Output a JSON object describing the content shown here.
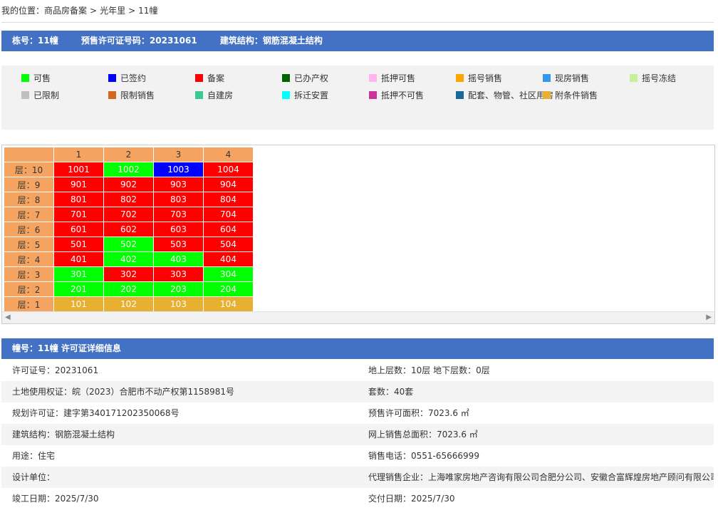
{
  "breadcrumb": {
    "prefix": "我的位置：",
    "items": [
      "商品房备案",
      "光年里",
      "11幢"
    ],
    "sep": ">"
  },
  "header": {
    "building": "栋号：11幢",
    "permit": "预售许可证号码：20231061",
    "structure": "建筑结构：钢筋混凝土结构"
  },
  "legend": [
    {
      "label": "可售",
      "color": "#00ff00"
    },
    {
      "label": "已签约",
      "color": "#0000ff"
    },
    {
      "label": "备案",
      "color": "#ff0000"
    },
    {
      "label": "已办产权",
      "color": "#006400"
    },
    {
      "label": "抵押可售",
      "color": "#ffb6f0"
    },
    {
      "label": "摇号销售",
      "color": "#ffa500"
    },
    {
      "label": "现房销售",
      "color": "#3399ee"
    },
    {
      "label": "摇号冻结",
      "color": "#c8f09a"
    },
    {
      "label": "已限制",
      "color": "#c0c0c0"
    },
    {
      "label": "限制销售",
      "color": "#d2691e"
    },
    {
      "label": "自建房",
      "color": "#3cc890"
    },
    {
      "label": "拆迁安置",
      "color": "#00ffff"
    },
    {
      "label": "抵押不可售",
      "color": "#cc3399"
    },
    {
      "label": "配套、物管、社区用房",
      "color": "#1a6a99"
    },
    {
      "label": "附条件销售",
      "color": "#e8b030"
    }
  ],
  "grid": {
    "columns": [
      "1",
      "2",
      "3",
      "4"
    ],
    "floor_prefix": "层：",
    "status_colors": {
      "available": "#00ff00",
      "signed": "#0000ff",
      "filed": "#ff0000",
      "conditional": "#e8b030"
    },
    "rows": [
      {
        "floor": "10",
        "units": [
          [
            "1001",
            "filed"
          ],
          [
            "1002",
            "available"
          ],
          [
            "1003",
            "signed"
          ],
          [
            "1004",
            "filed"
          ]
        ]
      },
      {
        "floor": "9",
        "units": [
          [
            "901",
            "filed"
          ],
          [
            "902",
            "filed"
          ],
          [
            "903",
            "filed"
          ],
          [
            "904",
            "filed"
          ]
        ]
      },
      {
        "floor": "8",
        "units": [
          [
            "801",
            "filed"
          ],
          [
            "802",
            "filed"
          ],
          [
            "803",
            "filed"
          ],
          [
            "804",
            "filed"
          ]
        ]
      },
      {
        "floor": "7",
        "units": [
          [
            "701",
            "filed"
          ],
          [
            "702",
            "filed"
          ],
          [
            "703",
            "filed"
          ],
          [
            "704",
            "filed"
          ]
        ]
      },
      {
        "floor": "6",
        "units": [
          [
            "601",
            "filed"
          ],
          [
            "602",
            "filed"
          ],
          [
            "603",
            "filed"
          ],
          [
            "604",
            "filed"
          ]
        ]
      },
      {
        "floor": "5",
        "units": [
          [
            "501",
            "filed"
          ],
          [
            "502",
            "available"
          ],
          [
            "503",
            "filed"
          ],
          [
            "504",
            "filed"
          ]
        ]
      },
      {
        "floor": "4",
        "units": [
          [
            "401",
            "filed"
          ],
          [
            "402",
            "available"
          ],
          [
            "403",
            "available"
          ],
          [
            "404",
            "filed"
          ]
        ]
      },
      {
        "floor": "3",
        "units": [
          [
            "301",
            "available"
          ],
          [
            "302",
            "filed"
          ],
          [
            "303",
            "filed"
          ],
          [
            "304",
            "available"
          ]
        ]
      },
      {
        "floor": "2",
        "units": [
          [
            "201",
            "available"
          ],
          [
            "202",
            "available"
          ],
          [
            "203",
            "available"
          ],
          [
            "204",
            "available"
          ]
        ]
      },
      {
        "floor": "1",
        "units": [
          [
            "101",
            "conditional"
          ],
          [
            "102",
            "conditional"
          ],
          [
            "103",
            "conditional"
          ],
          [
            "104",
            "conditional"
          ]
        ]
      }
    ]
  },
  "details_header": "幢号：11幢 许可证详细信息",
  "details": [
    {
      "left": "许可证号：20231061",
      "right": "地上层数：10层  地下层数：0层"
    },
    {
      "left": "土地使用权证：皖（2023）合肥市不动产权第1158981号",
      "right": "套数：40套"
    },
    {
      "left": "规划许可证：建字第340171202350068号",
      "right": "预售许可面积：7023.6 ㎡"
    },
    {
      "left": "建筑结构：钢筋混凝土结构",
      "right": "网上销售总面积：7023.6 ㎡"
    },
    {
      "left": "用途：住宅",
      "right": "销售电话：0551-65666999"
    },
    {
      "left": "设计单位：",
      "right": "代理销售企业：上海唯家房地产咨询有限公司合肥分公司、安徽合富辉煌房地产顾问有限公司"
    },
    {
      "left": "竣工日期：2025/7/30",
      "right": "交付日期：2025/7/30"
    }
  ]
}
